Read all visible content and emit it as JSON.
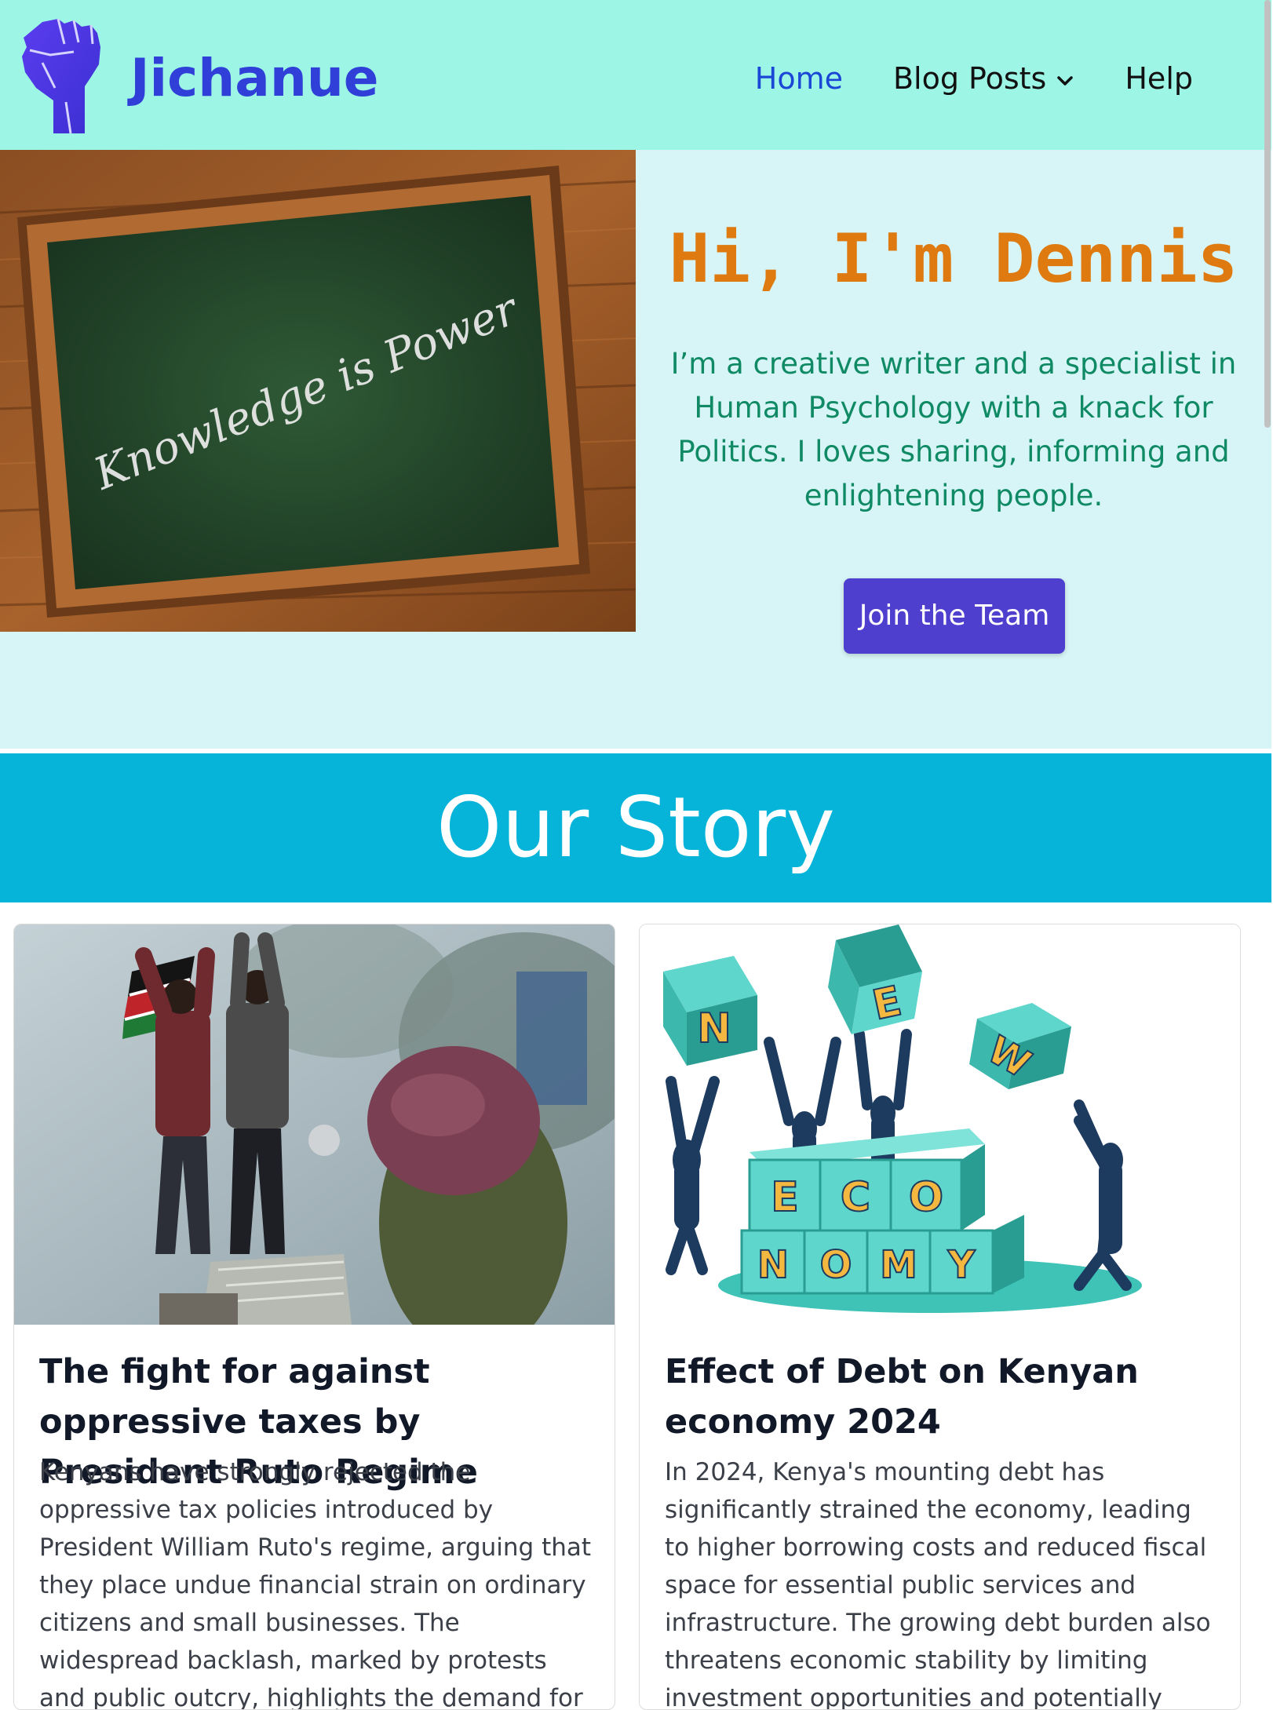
{
  "brand": {
    "name": "Jichanue",
    "logo_icon": "raised-fist-icon",
    "color": "#2f3fd8"
  },
  "nav": {
    "items": [
      {
        "label": "Home",
        "active": true
      },
      {
        "label": "Blog Posts",
        "icon": "chevron-down-icon"
      },
      {
        "label": "Help"
      }
    ]
  },
  "hero": {
    "image_text": "Knowledge is Power",
    "title": "Hi, I'm Dennis",
    "text": "I’m a creative writer and a specialist in Human Psychology with a knack for Politics. I loves sharing, informing and enlightening people.",
    "button_label": "Join the Team",
    "colors": {
      "title": "#de7a10",
      "text": "#108a64",
      "button": "#4f3fcf"
    }
  },
  "story": {
    "title": "Our Story",
    "background": "#06b4d9"
  },
  "cards": [
    {
      "title": "The fight for against oppressive taxes by President Ruto Regime",
      "text": "Kenyans have strongly rejected the oppressive tax policies introduced by President William Ruto's regime, arguing that they place undue financial strain on ordinary citizens and small businesses. The widespread backlash, marked by protests and public outcry, highlights the demand for more equitable and just fiscal policies."
    },
    {
      "title": "Effect of Debt on Kenyan economy 2024",
      "text": "In 2024, Kenya's mounting debt has significantly strained the economy, leading to higher borrowing costs and reduced fiscal space for essential public services and infrastructure. The growing debt burden also threatens economic stability by limiting investment opportunities and potentially increasing the risk of a debt crisis.",
      "image_letters": [
        "N",
        "E",
        "W",
        "E",
        "C",
        "O",
        "N",
        "O",
        "M",
        "Y"
      ]
    }
  ]
}
